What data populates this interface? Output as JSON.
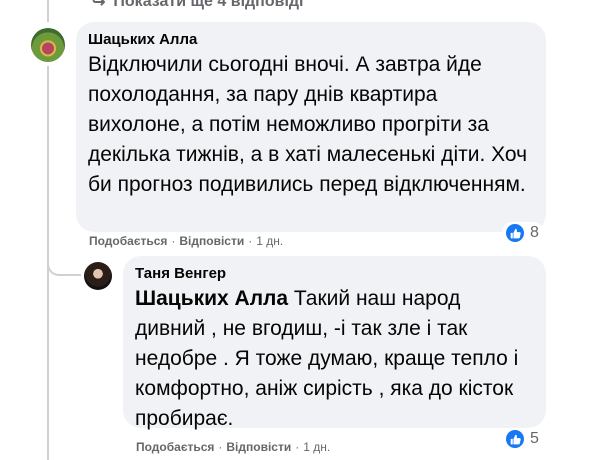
{
  "show_more_replies": "Показати ще 4 відповіді",
  "comments": [
    {
      "author": "Шацьких Алла",
      "text": "Відключили сьогодні вночі. А завтра йде похолодання, за пару днів квартира вихолоне, а потім неможливо прогріти за декілька тижнів, а в хаті малесенькі діти. Хоч би прогноз подивились перед відключенням.",
      "actions": {
        "like": "Подобається",
        "reply": "Відповісти",
        "time": "1 дн."
      },
      "reaction_count": "8",
      "reaction_icon": "thumbs-up-icon"
    },
    {
      "author": "Таня Венгер",
      "mention": "Шацьких Алла",
      "text": " Такий наш народ дивний , не вгодиш, -і так зле і так недобре . Я тоже думаю, краще тепло і комфортно, аніж сирість , яка до кісток пробирає.",
      "actions": {
        "like": "Подобається",
        "reply": "Відповісти",
        "time": "1 дн."
      },
      "reaction_count": "5",
      "reaction_icon": "thumbs-up-icon"
    }
  ],
  "colors": {
    "bubble": "#f0f2f5",
    "meta": "#65676b",
    "like_blue": "#1877f2",
    "thread_line": "#ced0d4"
  },
  "separator": "·"
}
